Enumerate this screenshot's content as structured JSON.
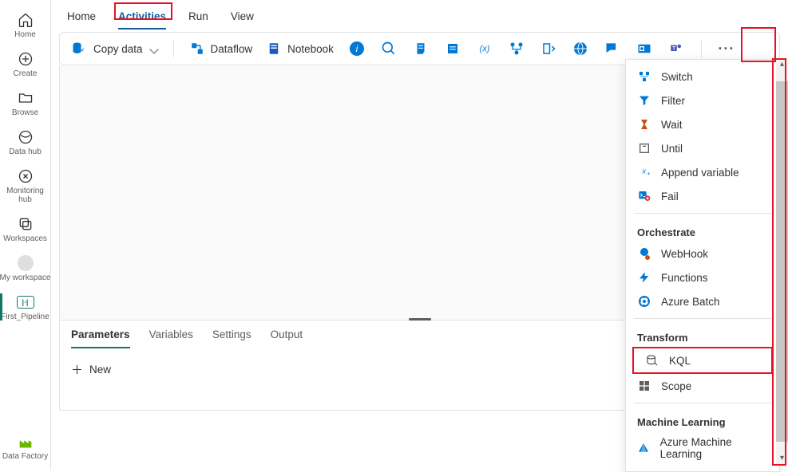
{
  "leftnav": {
    "home": "Home",
    "create": "Create",
    "browse": "Browse",
    "datahub": "Data hub",
    "monitoring": "Monitoring hub",
    "workspaces": "Workspaces",
    "myworkspace": "My workspace",
    "pipeline": "First_Pipeline",
    "factory": "Data Factory"
  },
  "menubar": {
    "home": "Home",
    "activities": "Activities",
    "run": "Run",
    "view": "View"
  },
  "toolbar": {
    "copy": "Copy data",
    "dataflow": "Dataflow",
    "notebook": "Notebook"
  },
  "bottomTabs": {
    "parameters": "Parameters",
    "variables": "Variables",
    "settings": "Settings",
    "output": "Output"
  },
  "new_label": "New",
  "dropdown": {
    "switch": "Switch",
    "filter": "Filter",
    "wait": "Wait",
    "until": "Until",
    "append": "Append variable",
    "fail": "Fail",
    "orchestrate": "Orchestrate",
    "webhook": "WebHook",
    "functions": "Functions",
    "batch": "Azure Batch",
    "transform": "Transform",
    "kql": "KQL",
    "scope": "Scope",
    "ml": "Machine Learning",
    "azml": "Azure Machine Learning"
  },
  "icon_colors": {
    "blue": "#0078d4",
    "darkblue": "#185abd",
    "teal": "#117865",
    "red": "#d13438",
    "amber": "#ca5010",
    "grey": "#605e5c"
  }
}
